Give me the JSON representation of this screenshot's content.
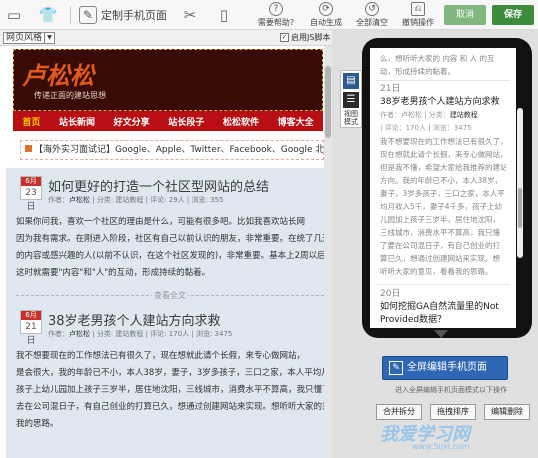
{
  "toolbar": {
    "title": "定制手机页面",
    "help": "需要帮助?",
    "auto_generate": "自动生成",
    "clear_all": "全部清空",
    "undo": "撤销操作",
    "cancel": "取消",
    "save": "保存"
  },
  "subbar": {
    "style_select": "网页风格",
    "js_toggle": "启用JS脚本",
    "js_checked": true
  },
  "site": {
    "logo": "卢松松",
    "slogan": "传递正面的建站思想",
    "nav": [
      "首页",
      "站长新闻",
      "好文分享",
      "站长段子",
      "松松软件",
      "博客大全"
    ],
    "news_ticker": "【海外实习面试记】Google、Apple、Twitter、Facebook、Google 北京沟面试"
  },
  "articles": [
    {
      "month": "6月",
      "day": "23日",
      "title": "如何更好的打造一个社区型网站的总结",
      "author_label": "作者：",
      "author": "卢松松",
      "meta_rest": "| 分类: 建站教程 | 评论: 29人 | 浏览: 355",
      "body": [
        "如果你问我，喜欢一个社区的理由是什么，可能有很多吧。比如我喜欢站长网",
        "因为我有需求。在刚进入阶段，社区有自己以前认识的朋友，非常重要。在统了几天",
        "的内容或感兴趣的人(以前不认识，在这个社区发现的)，非常重要。基本上2周以后，",
        "这时就需要\"内容\"和\"人\"的互动，形成持续的黏着。"
      ]
    },
    {
      "month": "6月",
      "day": "21日",
      "title": "38岁老男孩个人建站方向求救",
      "author_label": "作者：",
      "author": "卢松松",
      "meta_rest": "| 分类: 建站教程 | 评论: 170人 | 浏览: 3475",
      "body": [
        "我不想要现在的工作想法已有很久了，现在想就此请个长假，来专心做网站，",
        "是会很大，我的年龄已不小，本人38岁，妻子，3岁多孩子，三口之家，本人平均月收",
        "孩子上幼儿园加上孩子三岁半，居住地沈阳，三线城市，消费水平不算高，我只懂了",
        "去在公司混日子，有自己创业的打算已久，想通过创建网站来实现。想听听大家的意见",
        "我的思路。"
      ]
    }
  ],
  "divider_text": "查看全文",
  "mode_label": "视图模式",
  "phone": {
    "top_lines": [
      "么，想听听大家的   内容    和   人    的互",
      "动，形成持续的黏着。"
    ],
    "item": {
      "day": "21日",
      "title": "38岁老男孩个人建站方向求救",
      "meta_prefix": "作者：卢松松 | 分类：",
      "meta_cat": "建站教程",
      "meta_suffix": "| 评论：170人 | 浏览：3475",
      "body": [
        "我不想要现在的工作想法已有很久了，",
        "现在想就此请个长假，来专心做网站，",
        "但是我不懂，希望大家给我推荐的建站",
        "方向。我的年龄已不小，本人38岁，",
        "妻子，3岁多孩子，三口之家，本人平",
        "均月收入5千，妻子4千多，孩子上幼",
        "儿园加上孩子三岁半，居住地沈阳，",
        "三线城市，消费水平不算高，我只懂",
        "了要在公司混日子，有自己创业的打",
        "算已久，想通过创建网站来实现。想",
        "听听大家的意见，看看我的思路。"
      ]
    },
    "next": {
      "day": "20日",
      "title": "如何挖掘GA自然流量里的Not Provided数据？"
    }
  },
  "panel": {
    "fullscreen_btn": "全屏编辑手机页面",
    "hint": "进入全屏编辑手机页面模式以下操作",
    "merge_btn": "合并拆分",
    "drag_btn": "拖拽排序",
    "delete_btn": "编辑删除"
  },
  "watermark": {
    "logo": "我爱学习网",
    "url": "www.5ijxi.com"
  },
  "colors": {
    "nav_red": "#b80e14",
    "save_green": "#3c8c3c",
    "primary_blue": "#2e67b3"
  }
}
